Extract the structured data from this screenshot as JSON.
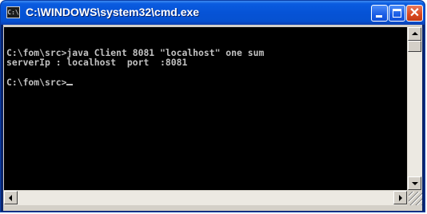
{
  "window": {
    "title": "C:\\WINDOWS\\system32\\cmd.exe",
    "app_icon": "cmd-icon",
    "app_icon_glyph": "C:\\"
  },
  "titlebar_buttons": {
    "minimize": "minimize-icon",
    "maximize": "maximize-icon",
    "close": "close-icon",
    "close_glyph": "✕"
  },
  "console": {
    "lines": [
      "C:\\fom\\src>java Client 8081 \"localhost\" one sum",
      "serverIp : localhost  port  :8081",
      "C:\\fom\\src>"
    ],
    "colors": {
      "background": "#000000",
      "foreground": "#c0c0c0"
    }
  },
  "colors": {
    "titlebar": "#0653d6",
    "close_button": "#d9471d",
    "chrome": "#d4d0c8"
  }
}
